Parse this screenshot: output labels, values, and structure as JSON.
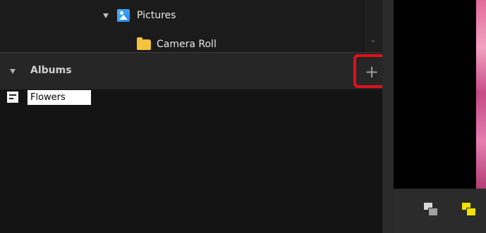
{
  "folder_tree": {
    "items": [
      {
        "label": "Pictures",
        "icon": "pictures-icon",
        "expanded": true
      },
      {
        "label": "Camera Roll",
        "icon": "folder-icon"
      }
    ]
  },
  "albums": {
    "title": "Albums",
    "expanded": true,
    "add_button_label": "+",
    "new_album_value": "Flowers",
    "highlight_color": "#e0101a"
  },
  "toolbar": {
    "icons": [
      "stack-icon-gray",
      "stack-icon-yellow"
    ],
    "accent": "#f2e200"
  }
}
